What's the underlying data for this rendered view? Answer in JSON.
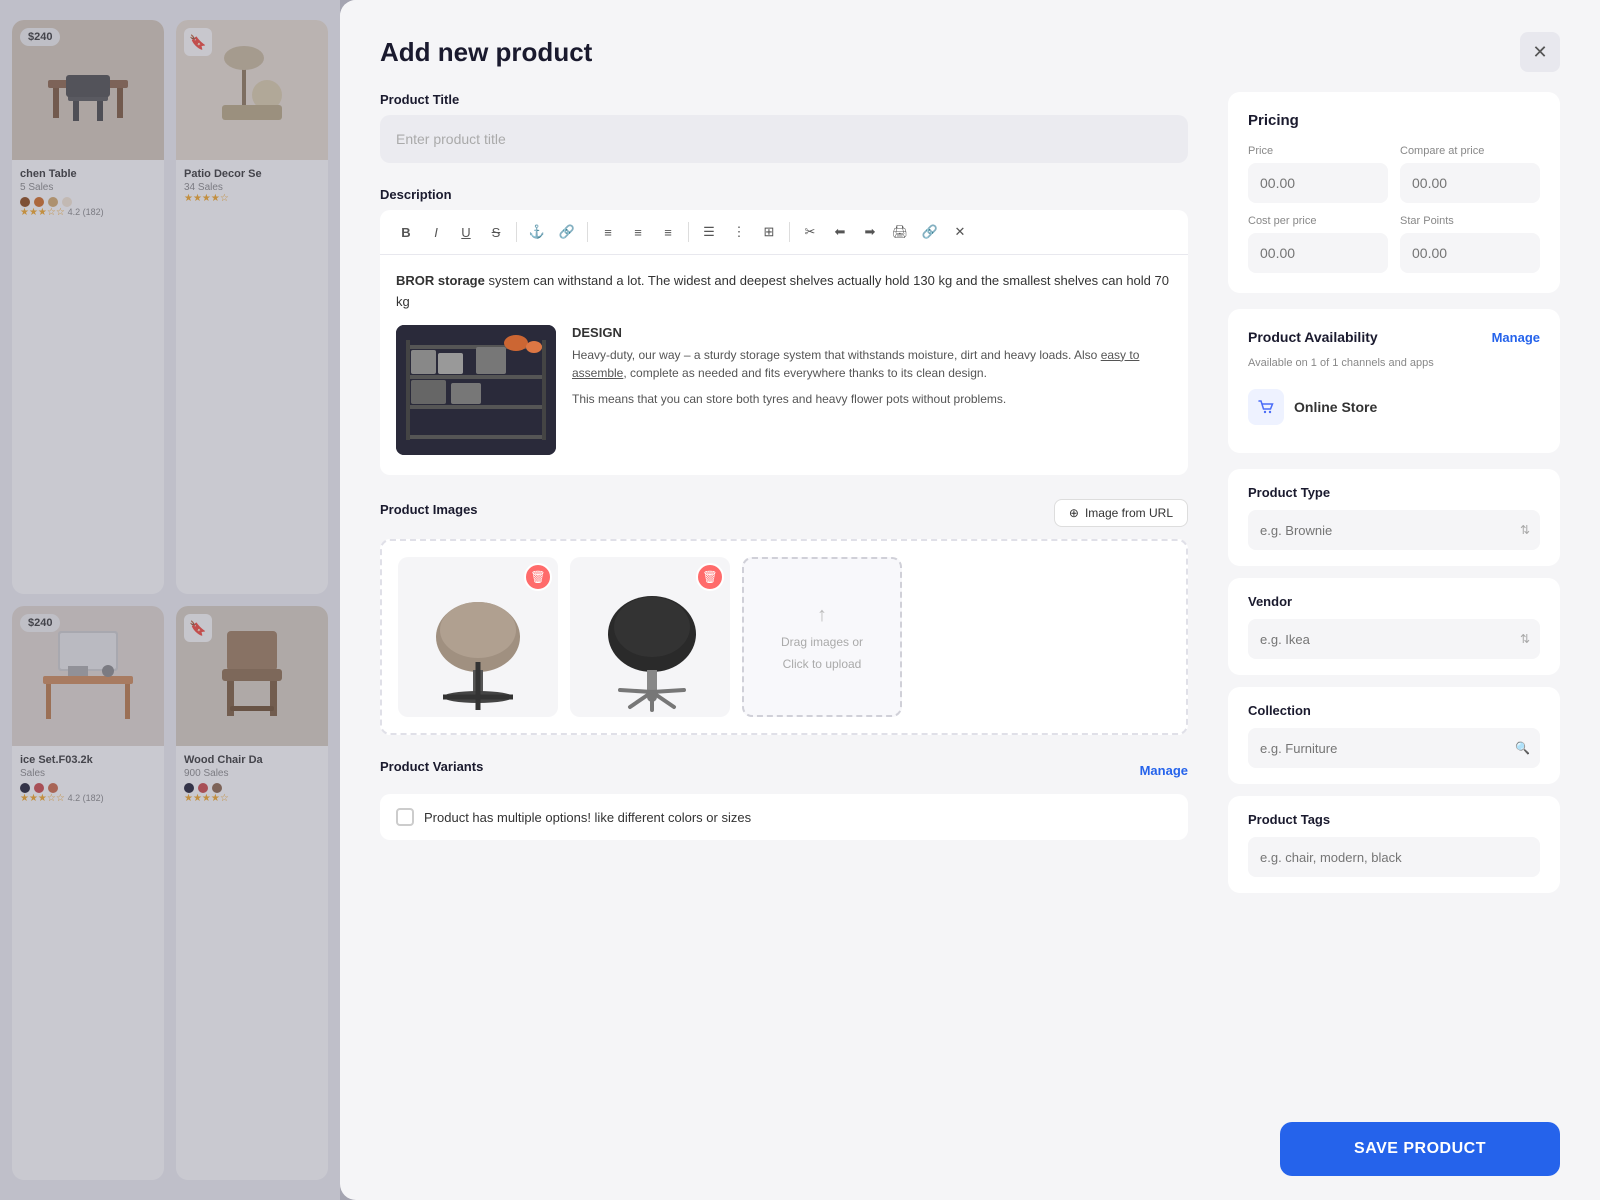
{
  "modal": {
    "title": "Add new product",
    "close_label": "✕"
  },
  "product_title": {
    "label": "Product Title",
    "placeholder": "Enter product title"
  },
  "description": {
    "label": "Description",
    "body_text": "BROR storage system can withstand a lot. The widest and deepest shelves actually hold 130 kg and the smallest shelves can hold 70 kg",
    "bold_word": "BROR storage",
    "design_title": "DESIGN",
    "design_text1": "Heavy-duty, our way – a sturdy storage system that withstands moisture, dirt and heavy loads. Also ",
    "design_link": "easy to assemble",
    "design_text2": ", complete as needed and fits everywhere thanks to its clean design.",
    "design_text3": "This means that you can store both tyres and heavy flower pots without problems."
  },
  "toolbar": {
    "buttons": [
      "B",
      "I",
      "U",
      "S",
      "⚓",
      "🔗",
      "≡",
      "≡",
      "≡",
      "≡",
      "⋮≡",
      "⊞",
      "✂",
      "⬅",
      "➡",
      "🖨",
      "🔗",
      "✕"
    ]
  },
  "product_images": {
    "label": "Product Images",
    "url_btn": "Image from URL",
    "upload_text1": "Drag images or",
    "upload_text2": "Click to upload"
  },
  "product_variants": {
    "label": "Product Variants",
    "manage_label": "Manage",
    "checkbox_label": "Product has multiple options! like different colors or sizes"
  },
  "pricing": {
    "title": "Pricing",
    "price_label": "Price",
    "compare_label": "Compare at price",
    "cost_label": "Cost per price",
    "stars_label": "Star Points",
    "placeholder": "00.00"
  },
  "availability": {
    "title": "Product Availability",
    "manage_label": "Manage",
    "subtitle": "Available on 1 of 1 channels and apps",
    "channel_name": "Online Store"
  },
  "product_type": {
    "title": "Product Type",
    "placeholder": "e.g. Brownie"
  },
  "vendor": {
    "title": "Vendor",
    "placeholder": "e.g. Ikea"
  },
  "collection": {
    "title": "Collection",
    "placeholder": "e.g. Furniture"
  },
  "product_tags": {
    "title": "Product Tags",
    "placeholder": "e.g. chair, modern, black"
  },
  "save_btn": "SAVE PRODUCT",
  "bg_cards": [
    {
      "id": "card1",
      "price": "$240",
      "title": "chen Table",
      "sales": "5 Sales",
      "rating": "4.2 (182)",
      "dots": [
        "#8B4513",
        "#D2691E",
        "#D4A96A",
        "#F5E6D3"
      ],
      "type": "table"
    },
    {
      "id": "card2",
      "bookmark": true,
      "title": "Patio Decor Se",
      "sales": "34 Sales",
      "rating": "4.5",
      "type": "patio"
    },
    {
      "id": "card3",
      "price": "$240",
      "title": "ice Set.F03.2k",
      "sales": "Sales",
      "rating": "4.2 (182)",
      "dots": [
        "#1a1a2e",
        "#cc4444",
        "#cc4444"
      ],
      "type": "desk"
    },
    {
      "id": "card4",
      "bookmark": true,
      "title": "Wood Chair Da",
      "sales": "900 Sales",
      "rating": "4.5",
      "type": "chair"
    }
  ]
}
